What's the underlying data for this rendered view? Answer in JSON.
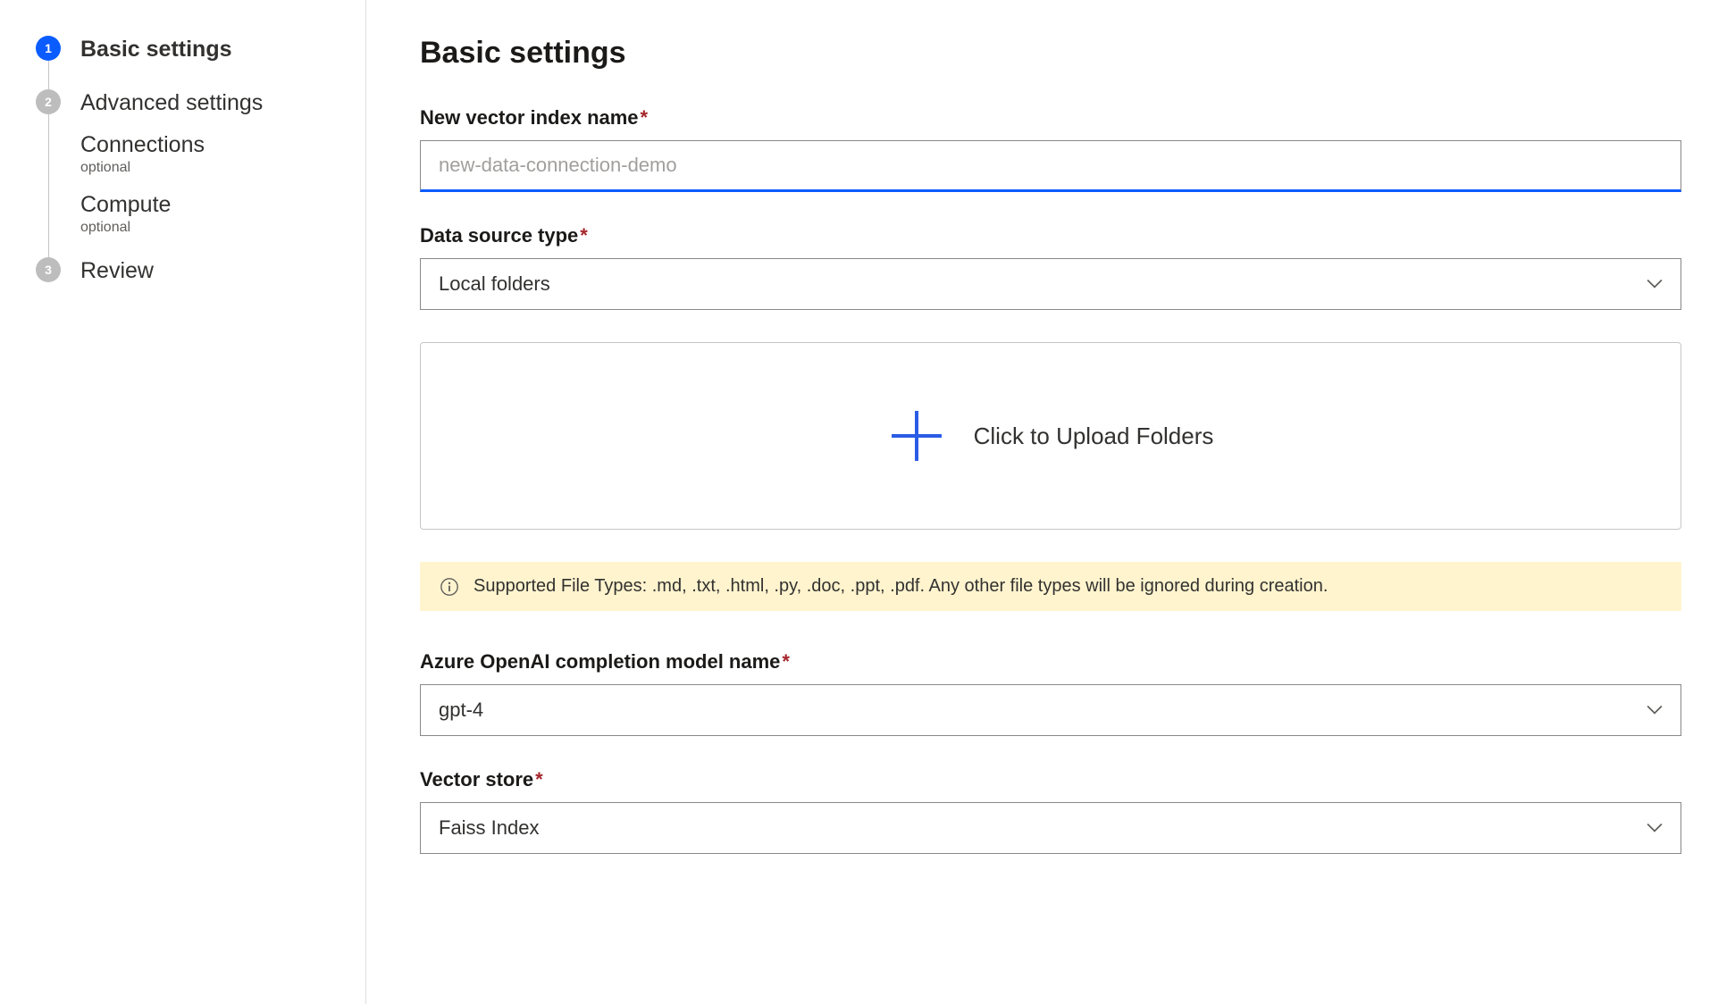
{
  "sidebar": {
    "steps": [
      {
        "num": "1",
        "label": "Basic settings",
        "active": true
      },
      {
        "num": "2",
        "label": "Advanced settings",
        "active": false,
        "subs": [
          {
            "label": "Connections",
            "tag": "optional"
          },
          {
            "label": "Compute",
            "tag": "optional"
          }
        ]
      },
      {
        "num": "3",
        "label": "Review",
        "active": false
      }
    ]
  },
  "main": {
    "title": "Basic settings",
    "index_name": {
      "label": "New vector index name",
      "placeholder": "new-data-connection-demo",
      "value": ""
    },
    "data_source_type": {
      "label": "Data source type",
      "value": "Local folders"
    },
    "upload": {
      "text": "Click to Upload Folders"
    },
    "info": {
      "text": "Supported File Types: .md, .txt, .html, .py, .doc, .ppt, .pdf. Any other file types will be ignored during creation."
    },
    "completion_model": {
      "label": "Azure OpenAI completion model name",
      "value": "gpt-4"
    },
    "vector_store": {
      "label": "Vector store",
      "value": "Faiss Index"
    },
    "required_mark": "*"
  }
}
